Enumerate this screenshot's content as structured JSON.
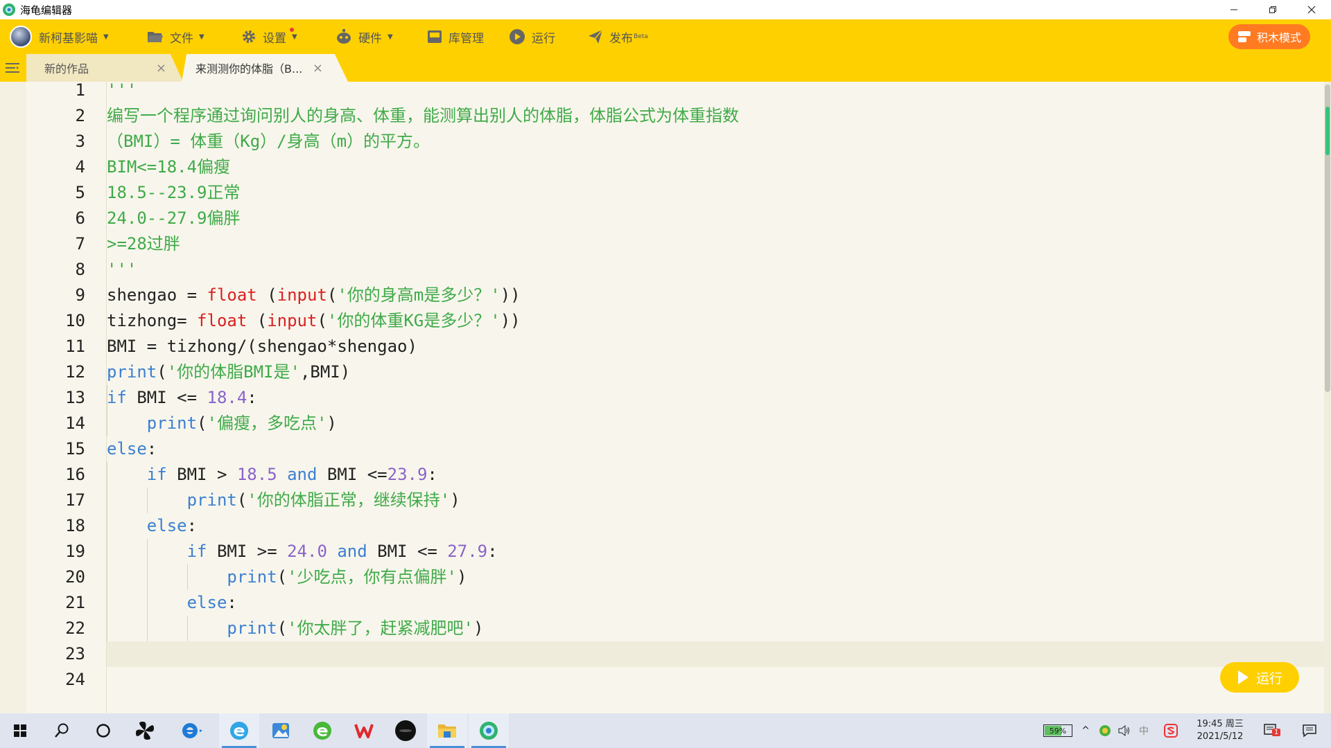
{
  "window": {
    "title": "海龟编辑器"
  },
  "toolbar": {
    "user_name": "新柯基影喵",
    "file_label": "文件",
    "settings_label": "设置",
    "hardware_label": "硬件",
    "library_label": "库管理",
    "run_label": "运行",
    "publish_label": "发布",
    "publish_badge": "Beta",
    "mode_label": "积木模式"
  },
  "tabs": [
    {
      "label": "新的作品"
    },
    {
      "label": "来测测你的体脂（B..."
    }
  ],
  "editor": {
    "line_numbers": [
      "1",
      "2",
      "3",
      "4",
      "5",
      "6",
      "7",
      "8",
      "9",
      "10",
      "11",
      "12",
      "13",
      "14",
      "15",
      "16",
      "17",
      "18",
      "19",
      "20",
      "21",
      "22",
      "23",
      "24"
    ],
    "current_line": 23,
    "lines": [
      [
        {
          "t": "'''",
          "c": "cm"
        }
      ],
      [
        {
          "t": "编写一个程序通过询问别人的身高、体重，能测算出别人的体脂，体脂公式为体重指数",
          "c": "cm"
        }
      ],
      [
        {
          "t": "（BMI）= 体重（Kg）/身高（m）的平方。",
          "c": "cm"
        }
      ],
      [
        {
          "t": "BIM<=18.4偏瘦",
          "c": "cm"
        }
      ],
      [
        {
          "t": "18.5--23.9正常",
          "c": "cm"
        }
      ],
      [
        {
          "t": "24.0--27.9偏胖",
          "c": "cm"
        }
      ],
      [
        {
          "t": ">=28过胖",
          "c": "cm"
        }
      ],
      [
        {
          "t": "'''",
          "c": "cm"
        }
      ],
      [
        {
          "t": "shengao = ",
          "c": ""
        },
        {
          "t": "float",
          "c": "bi"
        },
        {
          "t": " (",
          "c": ""
        },
        {
          "t": "input",
          "c": "bi"
        },
        {
          "t": "(",
          "c": ""
        },
        {
          "t": "'你的身高m是多少？'",
          "c": "str"
        },
        {
          "t": "))",
          "c": ""
        }
      ],
      [
        {
          "t": "tizhong= ",
          "c": ""
        },
        {
          "t": "float",
          "c": "bi"
        },
        {
          "t": " (",
          "c": ""
        },
        {
          "t": "input",
          "c": "bi"
        },
        {
          "t": "(",
          "c": ""
        },
        {
          "t": "'你的体重KG是多少？'",
          "c": "str"
        },
        {
          "t": "))",
          "c": ""
        }
      ],
      [
        {
          "t": "BMI = tizhong/(shengao*shengao)",
          "c": ""
        }
      ],
      [
        {
          "t": "print",
          "c": "kw"
        },
        {
          "t": "(",
          "c": ""
        },
        {
          "t": "'你的体脂BMI是'",
          "c": "str"
        },
        {
          "t": ",BMI)",
          "c": ""
        }
      ],
      [
        {
          "t": "if",
          "c": "kw"
        },
        {
          "t": " BMI <= ",
          "c": ""
        },
        {
          "t": "18.4",
          "c": "num"
        },
        {
          "t": ":",
          "c": ""
        }
      ],
      [
        {
          "t": "    ",
          "c": ""
        },
        {
          "t": "print",
          "c": "kw"
        },
        {
          "t": "(",
          "c": ""
        },
        {
          "t": "'偏瘦，多吃点'",
          "c": "str"
        },
        {
          "t": ")",
          "c": ""
        }
      ],
      [
        {
          "t": "else",
          "c": "kw"
        },
        {
          "t": ":",
          "c": ""
        }
      ],
      [
        {
          "t": "    ",
          "c": ""
        },
        {
          "t": "if",
          "c": "kw"
        },
        {
          "t": " BMI > ",
          "c": ""
        },
        {
          "t": "18.5",
          "c": "num"
        },
        {
          "t": " ",
          "c": ""
        },
        {
          "t": "and",
          "c": "kw"
        },
        {
          "t": " BMI <=",
          "c": ""
        },
        {
          "t": "23.9",
          "c": "num"
        },
        {
          "t": ":",
          "c": ""
        }
      ],
      [
        {
          "t": "        ",
          "c": ""
        },
        {
          "t": "print",
          "c": "kw"
        },
        {
          "t": "(",
          "c": ""
        },
        {
          "t": "'你的体脂正常，继续保持'",
          "c": "str"
        },
        {
          "t": ")",
          "c": ""
        }
      ],
      [
        {
          "t": "    ",
          "c": ""
        },
        {
          "t": "else",
          "c": "kw"
        },
        {
          "t": ":",
          "c": ""
        }
      ],
      [
        {
          "t": "        ",
          "c": ""
        },
        {
          "t": "if",
          "c": "kw"
        },
        {
          "t": " BMI >= ",
          "c": ""
        },
        {
          "t": "24.0",
          "c": "num"
        },
        {
          "t": " ",
          "c": ""
        },
        {
          "t": "and",
          "c": "kw"
        },
        {
          "t": " BMI <= ",
          "c": ""
        },
        {
          "t": "27.9",
          "c": "num"
        },
        {
          "t": ":",
          "c": ""
        }
      ],
      [
        {
          "t": "            ",
          "c": ""
        },
        {
          "t": "print",
          "c": "kw"
        },
        {
          "t": "(",
          "c": ""
        },
        {
          "t": "'少吃点，你有点偏胖'",
          "c": "str"
        },
        {
          "t": ")",
          "c": ""
        }
      ],
      [
        {
          "t": "        ",
          "c": ""
        },
        {
          "t": "else",
          "c": "kw"
        },
        {
          "t": ":",
          "c": ""
        }
      ],
      [
        {
          "t": "            ",
          "c": ""
        },
        {
          "t": "print",
          "c": "kw"
        },
        {
          "t": "(",
          "c": ""
        },
        {
          "t": "'你太胖了，赶紧减肥吧'",
          "c": "str"
        },
        {
          "t": ")",
          "c": ""
        }
      ],
      [],
      []
    ]
  },
  "run_button": {
    "label": "运行"
  },
  "taskbar": {
    "battery": "59%",
    "time": "19:45 周三",
    "date": "2021/5/12",
    "notification_count": "1",
    "ime_label": "中"
  },
  "colors": {
    "accent": "#ffd000",
    "mode_button": "#ff7a21",
    "comment": "#3faa49",
    "keyword": "#3c7fd1",
    "builtin": "#d92121",
    "number": "#8a63c9"
  }
}
